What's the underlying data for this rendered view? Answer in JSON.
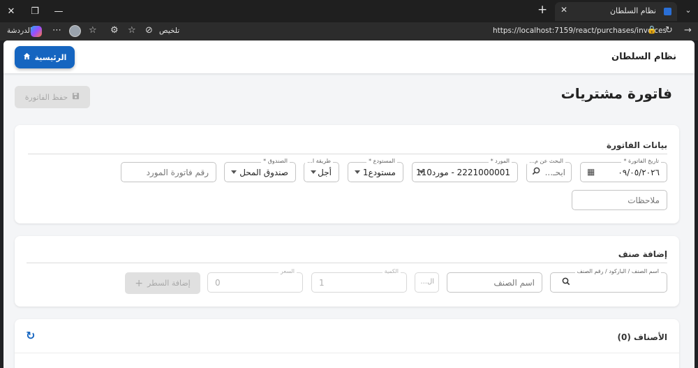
{
  "browser": {
    "tab_title": "نظام السلطان",
    "url": "https://localhost:7159/react/purchases/invoices",
    "summarize_label": "تلخيص",
    "chat_label": "الدردشة"
  },
  "app": {
    "brand": "نظام السلطان",
    "home_label": "الرئيسية",
    "page_title": "فاتورة مشتريات",
    "save_label": "حفظ الفاتورة"
  },
  "invoice": {
    "section_title": "بيانات الفاتورة",
    "date_label": "تاريخ الفاتورة *",
    "date_value": "٠٩/٠٥/٢٠٢٦",
    "search_label": "البحث عن م...",
    "search_placeholder": "ابحـ...",
    "supplier_label": "المورد *",
    "supplier_value": "2221000001 - مورد110",
    "warehouse_label": "المستودع *",
    "warehouse_value": "مستودع1",
    "payment_label": "طريقة ا...",
    "payment_value": "أجل",
    "cashbox_label": "الصندوق *",
    "cashbox_value": "صندوق المحل",
    "supplier_invoice_placeholder": "رقم فاتورة المورد",
    "notes_placeholder": "ملاحظات"
  },
  "add_item": {
    "section_title": "إضافة صنف",
    "code_label": "اسم الصنف / الباركود / رقم الصنف",
    "name_placeholder": "اسم الصنف",
    "unit_placeholder": "ال...",
    "qty_label": "الكمية",
    "qty_value": "1",
    "price_label": "السعر",
    "price_value": "0",
    "add_line_label": "إضافة السطر"
  },
  "items": {
    "title": "الأصناف (0)"
  }
}
